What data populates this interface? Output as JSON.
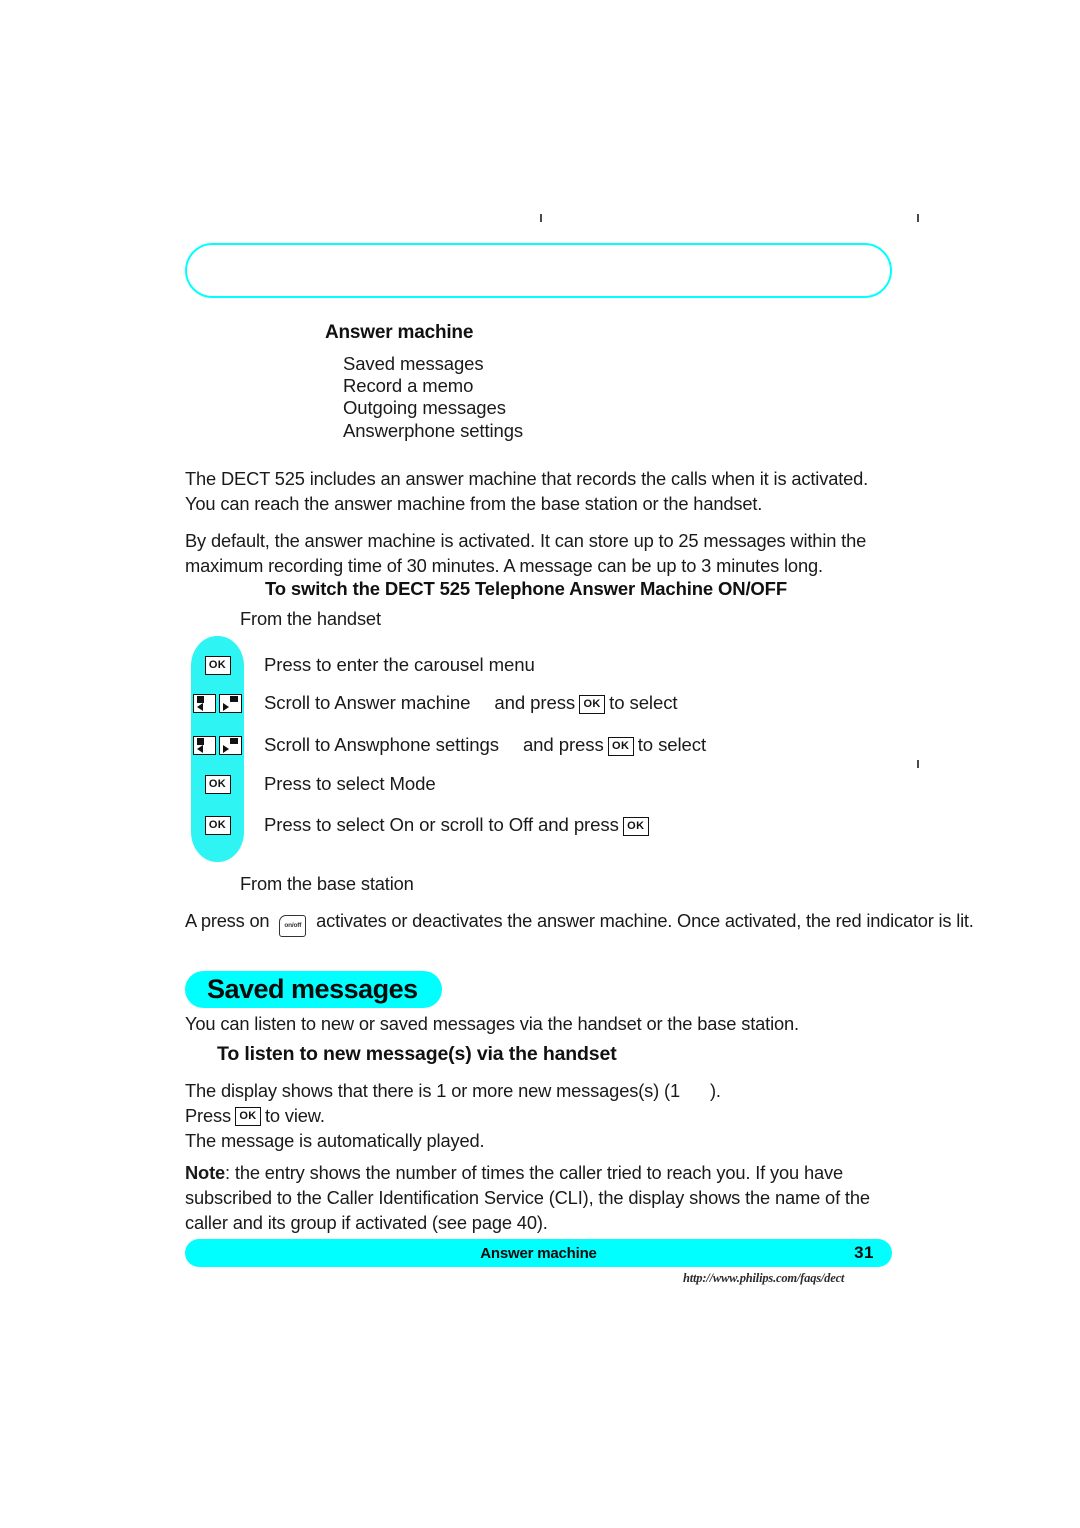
{
  "document": {
    "page_number": "31",
    "footer_title": "Answer machine",
    "footer_url": "http://www.philips.com/faqs/dect",
    "accent_color": "#00FFFF",
    "rail_color": "#2FF4F4"
  },
  "menu": {
    "title": "Answer machine",
    "items": [
      "Saved messages",
      "Record a memo",
      "Outgoing messages",
      "Answerphone settings"
    ]
  },
  "intro": {
    "paragraph_1": "The DECT 525 includes an answer machine that records the calls when it is activated. You can reach the answer machine from the base station or the handset.",
    "paragraph_2": "By default, the answer machine is activated. It can store up to 25 messages within the maximum recording time of 30 minutes. A message can be up to 3 minutes long."
  },
  "switch_section": {
    "heading": "To switch the DECT 525 Telephone Answer Machine ON/OFF",
    "from_handset_label": "From the handset",
    "from_base_label": "From the base station",
    "steps": [
      {
        "keys": [
          "ok"
        ],
        "text_before": "Press to enter the carousel menu",
        "text_mid": "",
        "inline_key": "",
        "text_after": ""
      },
      {
        "keys": [
          "scroll-left",
          "scroll-right"
        ],
        "text_before": "Scroll to Answer machine",
        "text_mid": "and press",
        "inline_key": "ok",
        "text_after": "to select"
      },
      {
        "keys": [
          "scroll-left",
          "scroll-right"
        ],
        "text_before": "Scroll to Answphone settings",
        "text_mid": "and press",
        "inline_key": "ok",
        "text_after": "to select"
      },
      {
        "keys": [
          "ok"
        ],
        "text_before": "Press to select Mode",
        "text_mid": "",
        "inline_key": "",
        "text_after": ""
      },
      {
        "keys": [
          "ok"
        ],
        "text_before": "Press to select On or scroll to Off and press",
        "text_mid": "",
        "inline_key": "ok",
        "text_after": ""
      }
    ],
    "base_sentence_before": "A press on",
    "base_key_label": "on/off",
    "base_sentence_after": "activates or deactivates the answer machine. Once activated, the red indicator is lit."
  },
  "saved_messages": {
    "heading": "Saved messages",
    "intro": "You can listen to new or saved messages via the handset or the base station.",
    "sub_heading": "To listen to new message(s) via the handset",
    "line_1_before": "The display shows that there is 1 or more new messages(s) (1",
    "line_1_after": ").",
    "line_2_before": "Press",
    "line_2_key": "ok",
    "line_2_after": "to view.",
    "line_3": "The message is automatically played.",
    "note_label": "Note",
    "note_text": ": the entry shows the number of times the caller tried to reach you. If you have subscribed to the Caller Identification Service (CLI), the display shows the name of the caller and its group if activated (see page 40)."
  },
  "keys": {
    "ok_label": "OK",
    "onoff_label": "on/off"
  }
}
